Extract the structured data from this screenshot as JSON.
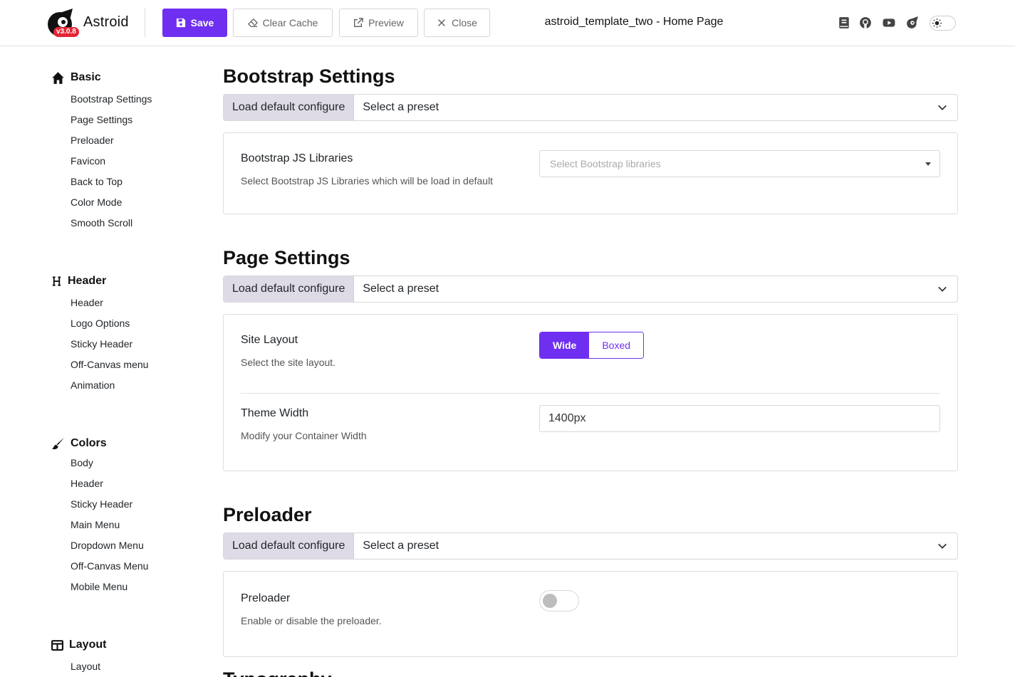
{
  "app": {
    "name": "Astroid",
    "version": "v3.0.8",
    "page_title": "astroid_template_two - Home Page"
  },
  "toolbar": {
    "save_label": "Save",
    "clear_cache_label": "Clear Cache",
    "preview_label": "Preview",
    "close_label": "Close",
    "icons": [
      "book-icon",
      "github-icon",
      "youtube-icon",
      "astroid-icon"
    ]
  },
  "colors": {
    "accent": "#6f2ff0",
    "version_badge": "#e32636",
    "preset_button_bg": "#dfdbe6"
  },
  "sidebar": {
    "groups": [
      {
        "title": "Basic",
        "icon": "home-icon",
        "items": [
          "Bootstrap Settings",
          "Page Settings",
          "Preloader",
          "Favicon",
          "Back to Top",
          "Color Mode",
          "Smooth Scroll"
        ]
      },
      {
        "title": "Header",
        "icon": "heading-icon",
        "items": [
          "Header",
          "Logo Options",
          "Sticky Header",
          "Off-Canvas menu",
          "Animation"
        ]
      },
      {
        "title": "Colors",
        "icon": "brush-icon",
        "items": [
          "Body",
          "Header",
          "Sticky Header",
          "Main Menu",
          "Dropdown Menu",
          "Off-Canvas Menu",
          "Mobile Menu"
        ]
      },
      {
        "title": "Layout",
        "icon": "layout-icon",
        "items": [
          "Layout"
        ]
      }
    ]
  },
  "sections": {
    "bootstrap": {
      "title": "Bootstrap Settings",
      "load_default": "Load default configure",
      "preset": "Select a preset",
      "fields": {
        "js_libraries": {
          "label": "Bootstrap JS Libraries",
          "description": "Select Bootstrap JS Libraries which will be load in default",
          "placeholder": "Select Bootstrap libraries"
        }
      }
    },
    "page": {
      "title": "Page Settings",
      "load_default": "Load default configure",
      "preset": "Select a preset",
      "fields": {
        "site_layout": {
          "label": "Site Layout",
          "description": "Select the site layout.",
          "options": [
            "Wide",
            "Boxed"
          ],
          "selected": "Wide"
        },
        "theme_width": {
          "label": "Theme Width",
          "description": "Modify your Container Width",
          "value": "1400px"
        }
      }
    },
    "preloader": {
      "title": "Preloader",
      "load_default": "Load default configure",
      "preset": "Select a preset",
      "fields": {
        "enabled": {
          "label": "Preloader",
          "description": "Enable or disable the preloader.",
          "value": false
        }
      }
    },
    "next": {
      "title": "Typography"
    }
  }
}
